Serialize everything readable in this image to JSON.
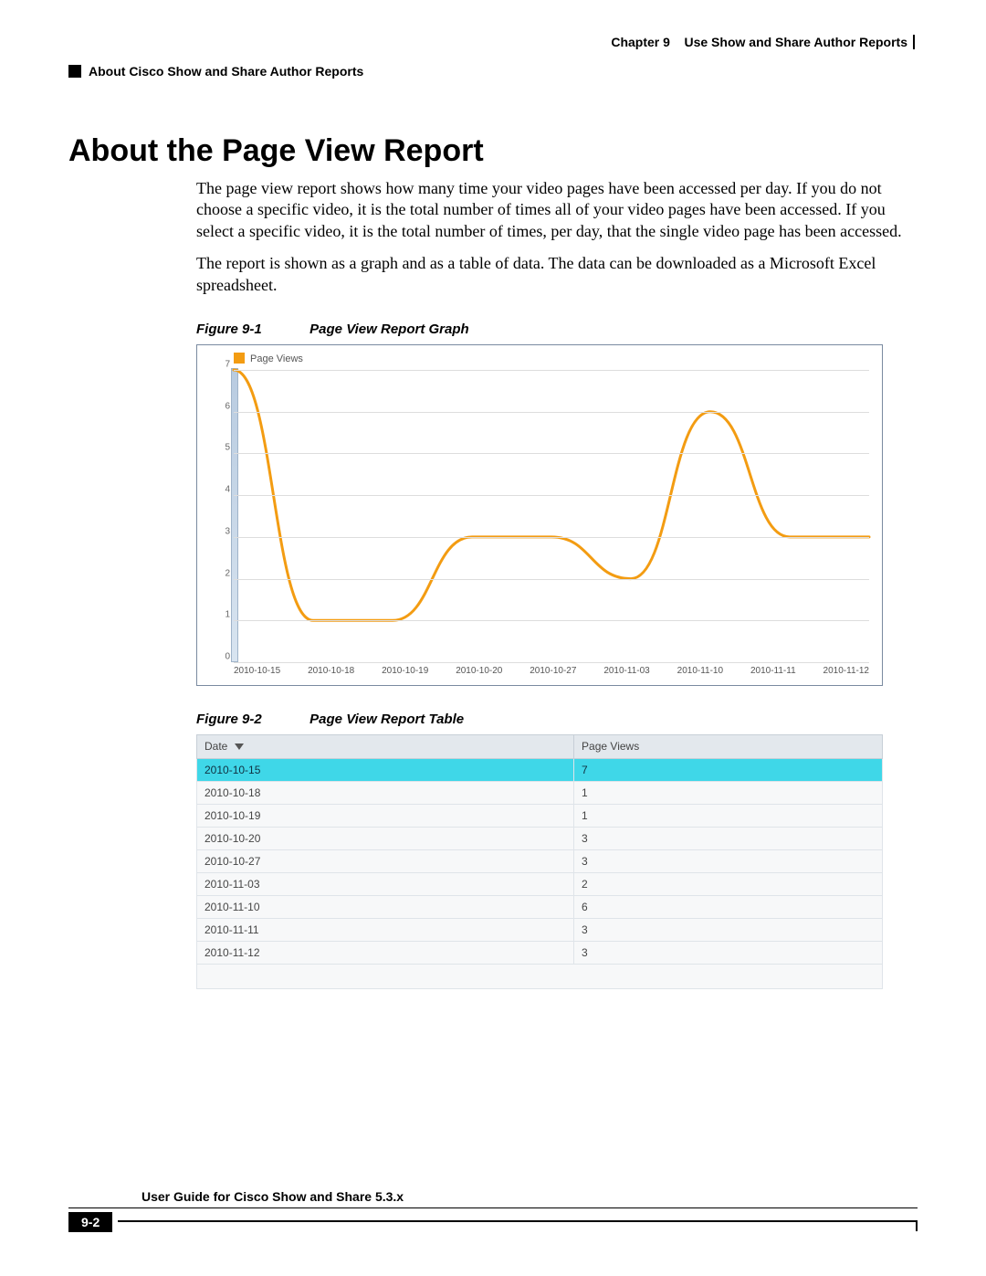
{
  "header": {
    "chapter_label": "Chapter 9",
    "chapter_title": "Use Show and Share Author Reports",
    "breadcrumb": "About Cisco Show and Share Author Reports"
  },
  "section_title": "About the Page View Report",
  "paragraphs": {
    "p1": "The page view report shows how many time your video pages have been accessed per day. If you do not choose a specific video, it is the total number of times all of your video pages have been accessed. If you select a specific video, it is the total number of times, per day, that the single video page has been accessed.",
    "p2": "The report is shown as a graph and as a table of data. The data can be downloaded as a Microsoft Excel spreadsheet."
  },
  "figure1": {
    "num": "Figure 9-1",
    "title": "Page View Report Graph"
  },
  "figure2": {
    "num": "Figure 9-2",
    "title": "Page View Report Table"
  },
  "legend_label": "Page Views",
  "chart_data": {
    "type": "line",
    "title": "",
    "xlabel": "",
    "ylabel": "",
    "ylim": [
      0,
      7
    ],
    "categories": [
      "2010-10-15",
      "2010-10-18",
      "2010-10-19",
      "2010-10-20",
      "2010-10-27",
      "2010-11-03",
      "2010-11-10",
      "2010-11-11",
      "2010-11-12"
    ],
    "series": [
      {
        "name": "Page Views",
        "values": [
          7,
          1,
          1,
          3,
          3,
          2,
          6,
          3,
          3
        ]
      }
    ],
    "y_ticks": [
      0,
      1,
      2,
      3,
      4,
      5,
      6,
      7
    ]
  },
  "table": {
    "columns": {
      "date": "Date",
      "views": "Page Views"
    },
    "rows": [
      {
        "date": "2010-10-15",
        "views": "7",
        "selected": true
      },
      {
        "date": "2010-10-18",
        "views": "1"
      },
      {
        "date": "2010-10-19",
        "views": "1"
      },
      {
        "date": "2010-10-20",
        "views": "3"
      },
      {
        "date": "2010-10-27",
        "views": "3"
      },
      {
        "date": "2010-11-03",
        "views": "2"
      },
      {
        "date": "2010-11-10",
        "views": "6"
      },
      {
        "date": "2010-11-11",
        "views": "3"
      },
      {
        "date": "2010-11-12",
        "views": "3"
      }
    ]
  },
  "footer": {
    "guide": "User Guide for Cisco Show and Share 5.3.x",
    "page": "9-2"
  }
}
